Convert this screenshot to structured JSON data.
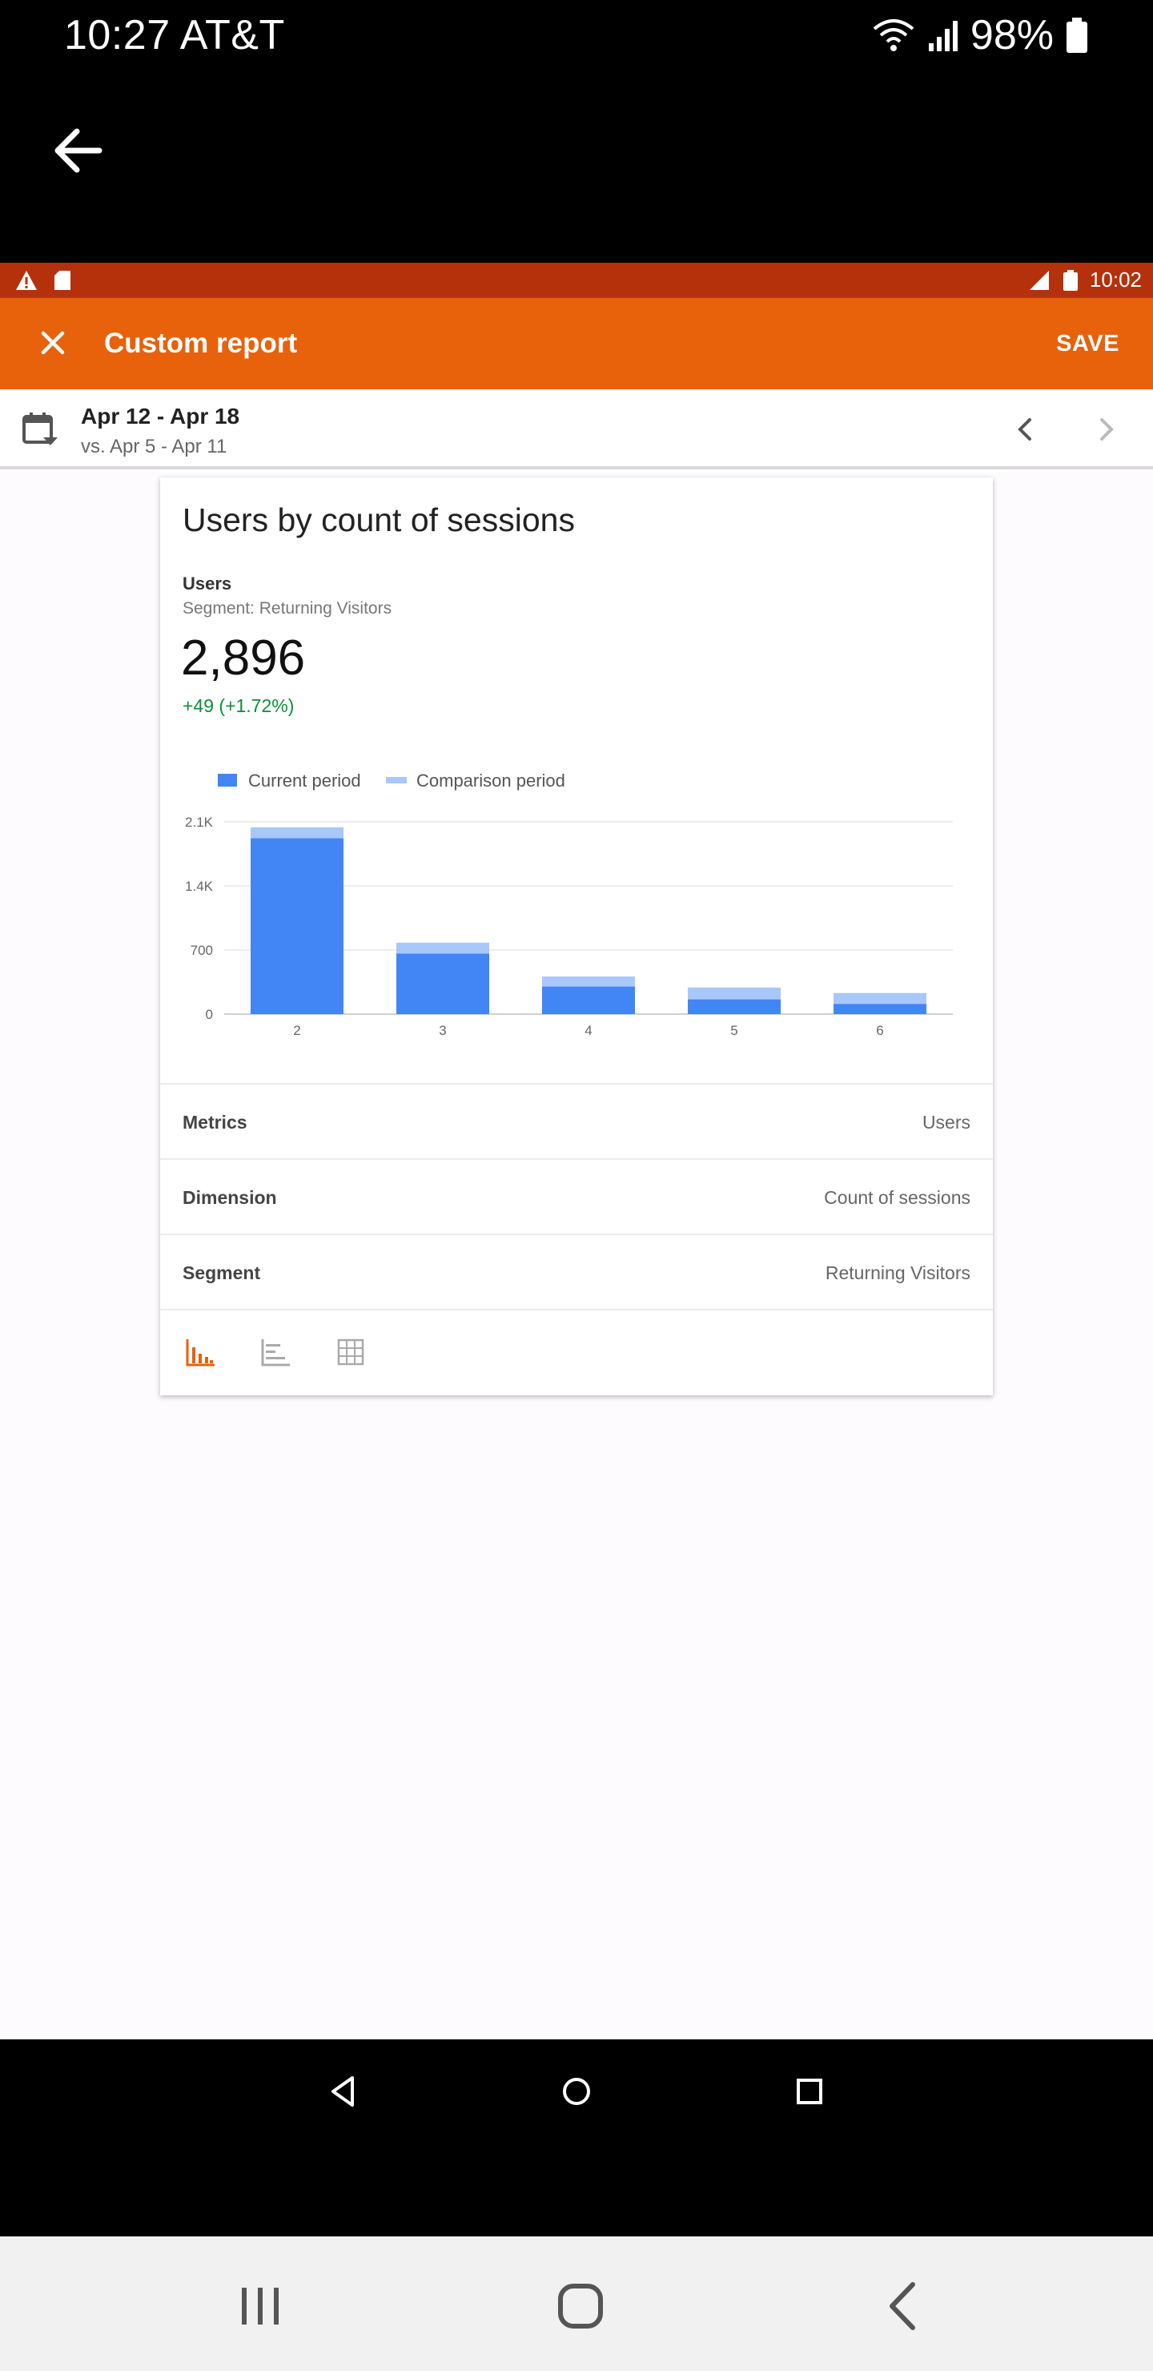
{
  "outer_status": {
    "time_carrier": "10:27 AT&T",
    "battery": "98%"
  },
  "inner_status": {
    "clock": "10:02"
  },
  "appbar": {
    "title": "Custom report",
    "save_label": "SAVE"
  },
  "date_range": {
    "primary": "Apr 12 - Apr 18",
    "comparison": "vs. Apr 5 - Apr 11"
  },
  "card": {
    "title": "Users by count of sessions",
    "metric_label": "Users",
    "segment_label": "Segment: Returning Visitors",
    "total": "2,896",
    "delta": "+49 (+1.72%)"
  },
  "colors": {
    "current": "#4285f4",
    "comparison": "#a8c7fa",
    "appbar": "#e8610b",
    "statusbar": "#b5310c",
    "positive": "#0a8f3a"
  },
  "chart_data": {
    "type": "bar",
    "categories": [
      "2",
      "3",
      "4",
      "5",
      "6"
    ],
    "series": [
      {
        "name": "Current period",
        "values": [
          1920,
          660,
          300,
          160,
          110
        ]
      },
      {
        "name": "Comparison period",
        "values": [
          2040,
          780,
          410,
          290,
          230
        ]
      }
    ],
    "yticks": [
      "0",
      "700",
      "1.4K",
      "2.1K"
    ],
    "ytick_values": [
      0,
      700,
      1400,
      2100
    ],
    "ylim": [
      0,
      2100
    ],
    "legend_position": "top-left",
    "grid": true
  },
  "settings": [
    {
      "key": "Metrics",
      "value": "Users"
    },
    {
      "key": "Dimension",
      "value": "Count of sessions"
    },
    {
      "key": "Segment",
      "value": "Returning Visitors"
    }
  ],
  "view_modes": [
    "bar-chart-icon",
    "horizontal-bar-icon",
    "table-grid-icon"
  ]
}
